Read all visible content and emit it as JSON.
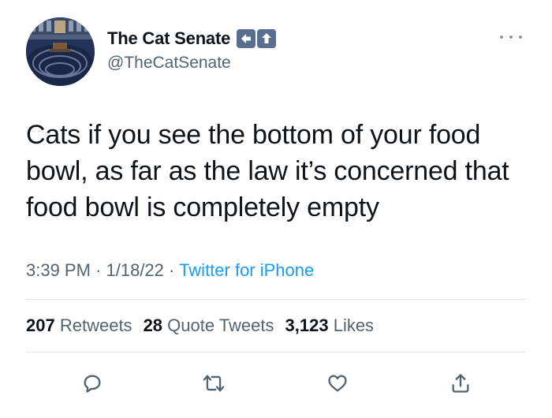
{
  "author": {
    "display_name": "The Cat Senate",
    "handle": "@TheCatSenate",
    "avatar_alt": "senate-chamber-avatar",
    "name_badges": [
      "left-arrow-emoji",
      "up-arrow-emoji"
    ]
  },
  "tweet": {
    "text": "Cats if you see the bottom of your food bowl, as far as the law it’s concerned that food bowl is completely empty"
  },
  "meta": {
    "time": "3:39 PM",
    "separator1": " · ",
    "date": "1/18/22",
    "separator2": " · ",
    "source": "Twitter for iPhone"
  },
  "stats": {
    "retweets_count": "207",
    "retweets_label": "Retweets",
    "quotes_count": "28",
    "quotes_label": "Quote Tweets",
    "likes_count": "3,123",
    "likes_label": "Likes"
  },
  "actions": [
    "reply-icon",
    "retweet-icon",
    "like-icon",
    "share-icon"
  ],
  "colors": {
    "text": "#0f1419",
    "secondary": "#536471",
    "link": "#1d9bf0",
    "divider": "#e1e6ea"
  }
}
